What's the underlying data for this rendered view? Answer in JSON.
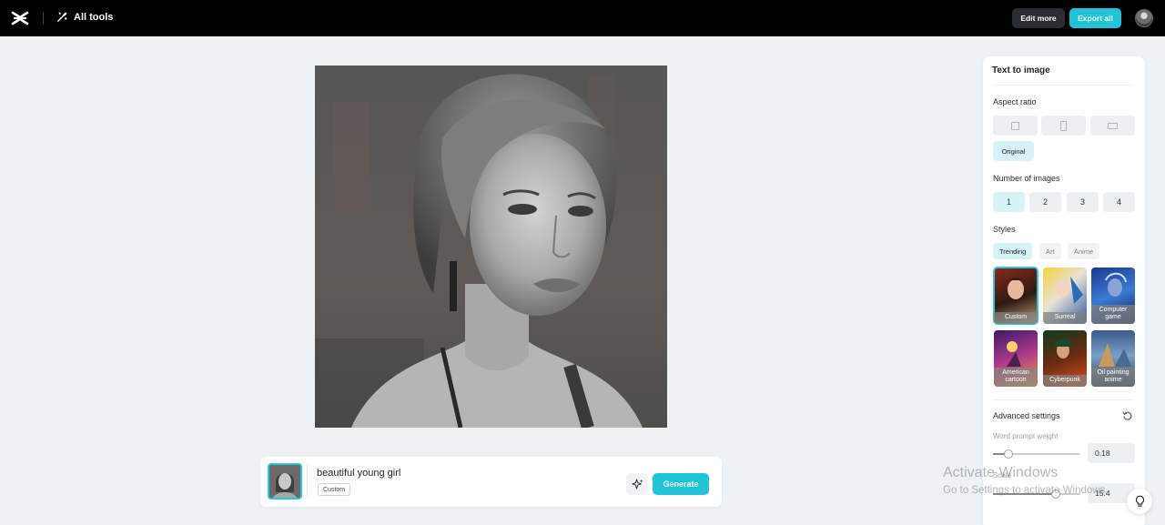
{
  "topbar": {
    "all_tools_label": "All tools",
    "edit_more_label": "Edit more",
    "export_all_label": "Export all",
    "accent_color": "#1fc4d8"
  },
  "prompt": {
    "text": "beautiful young girl",
    "style_tag": "Custom",
    "generate_label": "Generate"
  },
  "panel": {
    "title": "Text to image",
    "aspect_ratio": {
      "label": "Aspect ratio",
      "options": [
        "square-icon",
        "portrait-icon",
        "landscape-icon"
      ],
      "selected_label": "Original"
    },
    "number_of_images": {
      "label": "Number of images",
      "options": [
        "1",
        "2",
        "3",
        "4"
      ],
      "selected": "1"
    },
    "styles": {
      "label": "Styles",
      "tabs": [
        "Trending",
        "Art",
        "Anime"
      ],
      "selected_tab": "Trending",
      "cards": [
        {
          "label": "Custom",
          "selected": true
        },
        {
          "label": "Surreal",
          "selected": false
        },
        {
          "label": "Computer game",
          "selected": false
        },
        {
          "label": "American cartoon",
          "selected": false
        },
        {
          "label": "Cyberpunk",
          "selected": false
        },
        {
          "label": "Oil painting anime",
          "selected": false
        }
      ]
    },
    "advanced": {
      "label": "Advanced settings",
      "word_prompt_weight": {
        "label": "Word prompt weight",
        "value": "0.18",
        "level": 0.18
      },
      "scale": {
        "label": "Scale",
        "value": "15.4",
        "level": 0.72
      }
    }
  },
  "watermark": {
    "title": "Activate Windows",
    "subtitle": "Go to Settings to activate Windows."
  }
}
